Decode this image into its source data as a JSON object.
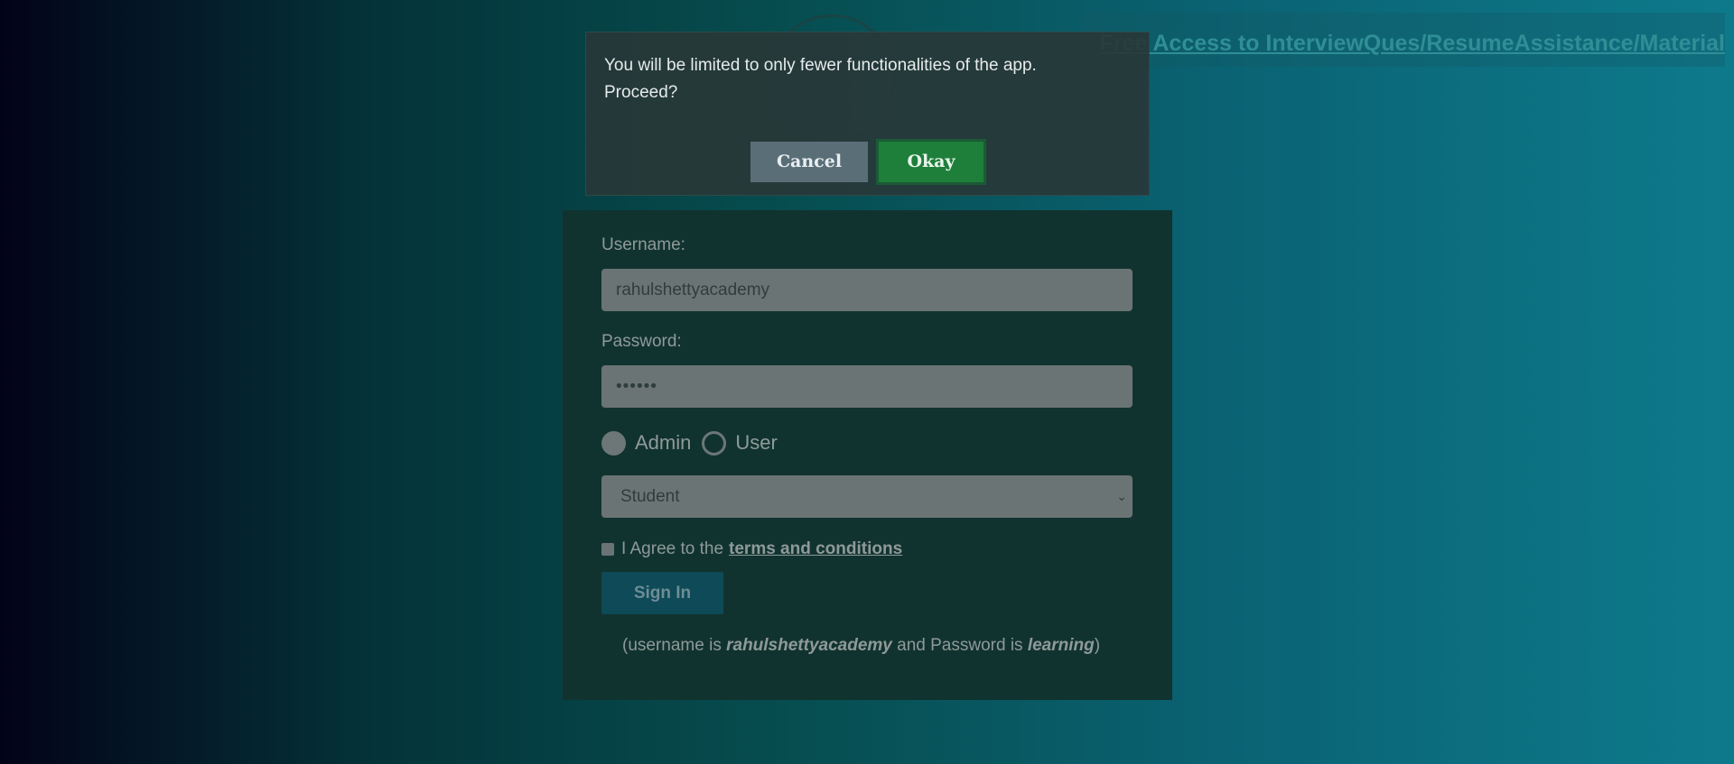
{
  "top_banner": {
    "link_text": "Free Access to InterviewQues/ResumeAssistance/Material"
  },
  "login_form": {
    "username_label": "Username:",
    "username_value": "rahulshettyacademy",
    "password_label": "Password:",
    "password_value": "••••••",
    "radio_options": [
      {
        "label": "Admin",
        "checked": true
      },
      {
        "label": "User",
        "checked": false
      }
    ],
    "role_select_value": "Student",
    "agree_text": "I Agree to the",
    "terms_link": "terms and conditions",
    "agree_checked": false,
    "signin_label": "Sign In",
    "hint": {
      "prefix": "(username is ",
      "username": "rahulshettyacademy",
      "middle": " and Password is ",
      "password": "learning",
      "suffix": ")"
    }
  },
  "modal": {
    "message": "You will be limited to only fewer functionalities of the app. Proceed?",
    "cancel_label": "Cancel",
    "okay_label": "Okay"
  },
  "colors": {
    "okay_button": "#1e7f3a",
    "cancel_button": "#5a6e78",
    "card_background": "#113330"
  }
}
